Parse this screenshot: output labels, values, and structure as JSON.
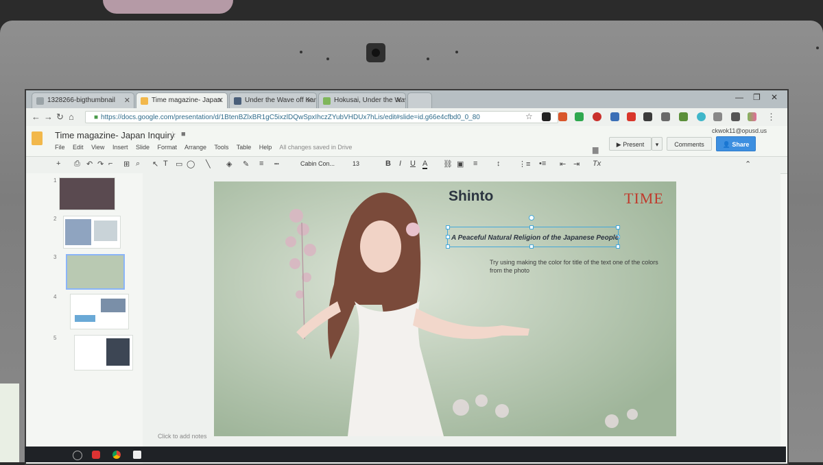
{
  "browser": {
    "tabs": [
      {
        "title": "1328266-bigthumbnail",
        "favicon_color": "#9aa3a7",
        "active": false
      },
      {
        "title": "Time magazine- Japan",
        "favicon_color": "#f2b84b",
        "active": true
      },
      {
        "title": "Under the Wave off Kana",
        "favicon_color": "#4a5f7a",
        "active": false
      },
      {
        "title": "Hokusai, Under the Wave",
        "favicon_color": "#7fb65a",
        "active": false
      }
    ],
    "url": "https://docs.google.com/presentation/d/1BtenBZlxBR1gC5ixzlDQwSpxIhczZYubVHDUx7hLis/edit#slide=id.g66e4cfbd0_0_80"
  },
  "app": {
    "doc_title": "Time magazine- Japan Inquiry",
    "menu": [
      "File",
      "Edit",
      "View",
      "Insert",
      "Slide",
      "Format",
      "Arrange",
      "Tools",
      "Table",
      "Help"
    ],
    "save_status": "All changes saved in Drive",
    "account": "ckwok11@opusd.us",
    "present_label": "Present",
    "comments_label": "Comments",
    "share_label": "Share"
  },
  "toolbar": {
    "font": "Cabin Con...",
    "font_size": "13",
    "bold": "B",
    "italic": "I",
    "underline": "U",
    "text_color": "A",
    "clear_format": "Tx"
  },
  "filmstrip": {
    "numbers": [
      "1",
      "2",
      "3",
      "4",
      "5"
    ]
  },
  "slide": {
    "title": "Shinto",
    "logo": "TIME",
    "subtitle": "A Peaceful  Natural Religion of the Japanese People",
    "hint": "Try using making the color for title of the text one of the colors from the photo",
    "notes_placeholder": "Click to add notes"
  },
  "colors": {
    "share_button": "#3d8fe0",
    "time_logo": "#c0392b",
    "selection": "#43a7d9"
  }
}
